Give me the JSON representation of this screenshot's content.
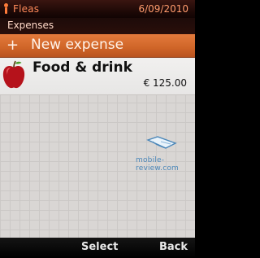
{
  "status_bar": {
    "app_name": "Fleas",
    "date": "6/09/2010"
  },
  "title_bar": {
    "title": "Expenses"
  },
  "new_expense": {
    "icon": "plus-icon",
    "label": "New expense"
  },
  "items": [
    {
      "icon": "apple-icon",
      "label": "Food & drink",
      "amount": "€ 125.00"
    }
  ],
  "watermark": {
    "text": "mobile-review.com"
  },
  "softkeys": {
    "middle": "Select",
    "right": "Back"
  },
  "colors": {
    "accent": "#d06a2c",
    "status_text": "#ff8a5a",
    "background": "#d9d6d4"
  }
}
